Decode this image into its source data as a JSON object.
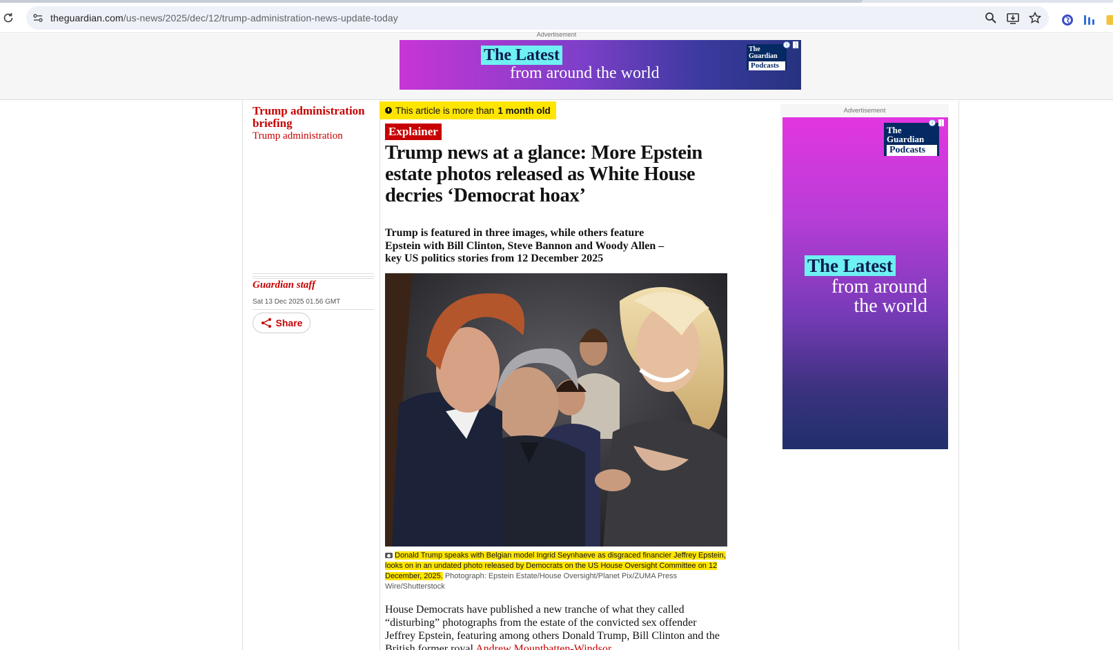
{
  "browser": {
    "url_host": "theguardian.com",
    "url_path": "/us-news/2025/dec/12/trump-administration-news-update-today"
  },
  "ads": {
    "top_label": "Advertisement",
    "top_banner_line1": "The Latest",
    "top_banner_line2": "from around the world",
    "logo_line1": "The",
    "logo_line2": "Guardian",
    "logo_line3": "Podcasts",
    "side_label": "Advertisement",
    "side_line1": "The Latest",
    "side_line2a": "from around",
    "side_line2b": "the world",
    "colors": {
      "magenta": "#e236e0",
      "navy": "#20306b",
      "cyan": "#6ff0f2"
    }
  },
  "meta": {
    "series": "Trump administration briefing",
    "section": "Trump administration",
    "byline": "Guardian staff",
    "date": "Sat 13 Dec 2025 01.56 GMT",
    "share_label": "Share"
  },
  "article": {
    "age_prefix": "This article is more than",
    "age_value": "1 month old",
    "kicker": "Explainer",
    "headline": "Trump news at a glance: More Epstein estate photos released as White House decries ‘Democrat hoax’",
    "standfirst": "Trump is featured in three images, while others feature Epstein with Bill Clinton, Steve Bannon and Woody Allen – key US politics stories from 12 December 2025",
    "caption_highlight": "Donald Trump speaks with Belgian model Ingrid Seynhaeve as disgraced financier Jeffrey Epstein, looks on in an undated photo released by Democrats on the US House Oversight Committee on 12 December, 2025.",
    "caption_credit": " Photograph: Epstein Estate/House Oversight/Planet Pix/ZUMA Press Wire/Shutterstock",
    "body_text": "House Democrats have published a new tranche of what they called “disturbing” photographs from the estate of the convicted sex offender Jeffrey Epstein, featuring among others Donald Trump, Bill Clinton and the British former royal ",
    "body_link": "Andrew Mountbatten-Windsor"
  },
  "theme": {
    "guardian_red": "#c70000",
    "highlight_yellow": "#ffe500"
  }
}
